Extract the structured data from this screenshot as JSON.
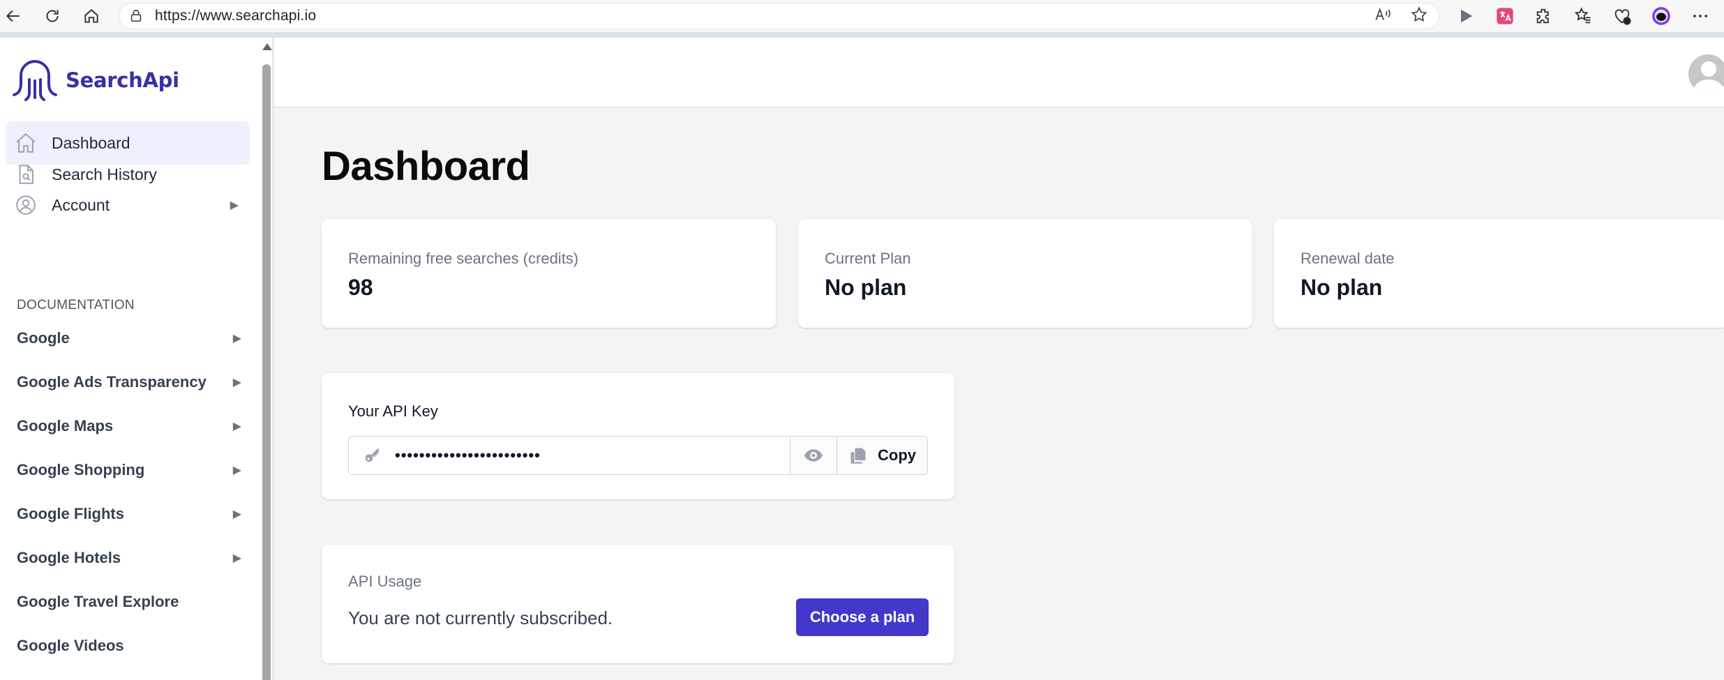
{
  "browser": {
    "url": "https://www.searchapi.io"
  },
  "brand": {
    "name": "SearchApi",
    "color": "#3730a3"
  },
  "sidebar": {
    "nav": [
      {
        "label": "Dashboard",
        "icon": "home-icon",
        "active": true
      },
      {
        "label": "Search History",
        "icon": "document-search-icon"
      },
      {
        "label": "Account",
        "icon": "user-circle-icon",
        "expandable": true
      }
    ],
    "documentation_label": "DOCUMENTATION",
    "docs": [
      {
        "label": "Google",
        "expandable": true
      },
      {
        "label": "Google Ads Transparency",
        "expandable": true
      },
      {
        "label": "Google Maps",
        "expandable": true
      },
      {
        "label": "Google Shopping",
        "expandable": true
      },
      {
        "label": "Google Flights",
        "expandable": true
      },
      {
        "label": "Google Hotels",
        "expandable": true
      },
      {
        "label": "Google Travel Explore"
      },
      {
        "label": "Google Videos"
      }
    ]
  },
  "main": {
    "title": "Dashboard",
    "stats": [
      {
        "label": "Remaining free searches (credits)",
        "value": "98"
      },
      {
        "label": "Current Plan",
        "value": "No plan"
      },
      {
        "label": "Renewal date",
        "value": "No plan"
      }
    ],
    "api_key": {
      "label": "Your API Key",
      "masked_value": "••••••••••••••••••••••••",
      "copy_label": "Copy"
    },
    "usage": {
      "label": "API Usage",
      "text": "You are not currently subscribed.",
      "button_label": "Choose a plan",
      "button_color": "#4338ca"
    }
  }
}
